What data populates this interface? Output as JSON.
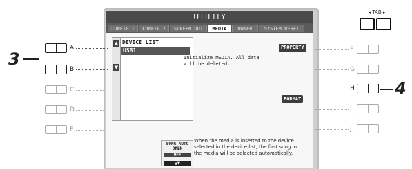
{
  "screen": {
    "title": "UTILITY",
    "tabs": [
      {
        "label": "CONFIG 1",
        "active": false
      },
      {
        "label": "CONFIG 2",
        "active": false
      },
      {
        "label": "SCREEN OUT",
        "active": false
      },
      {
        "label": "MEDIA",
        "active": true
      },
      {
        "label": "OWNER",
        "active": false
      },
      {
        "label": "SYSTEM RESET",
        "active": false
      }
    ],
    "device_list": {
      "header": "DEVICE LIST",
      "items": [
        "USB1"
      ],
      "selected": "USB1"
    },
    "property_button": "PROPERTY",
    "format_button": "FORMAT",
    "message": "Initialize MEDIA. All data will be deleted.",
    "song_auto_open": {
      "title": "SONG AUTO OPEN",
      "options": [
        "ON",
        "OFF"
      ],
      "selected": "OFF",
      "description": "When the media is inserted to the device selected in the device list, the first song in the media will be selected automatically."
    }
  },
  "panel": {
    "tab_label": "TAB",
    "left_buttons": [
      "A",
      "B",
      "C",
      "D",
      "E"
    ],
    "right_buttons": [
      "F",
      "G",
      "H",
      "I",
      "J"
    ]
  },
  "callouts": {
    "left": "3",
    "right": "4"
  },
  "colors": {
    "lcd_dark": "#4a4a4a",
    "lcd_bg": "#f7f7f7",
    "frame": "#cfcfcf"
  }
}
